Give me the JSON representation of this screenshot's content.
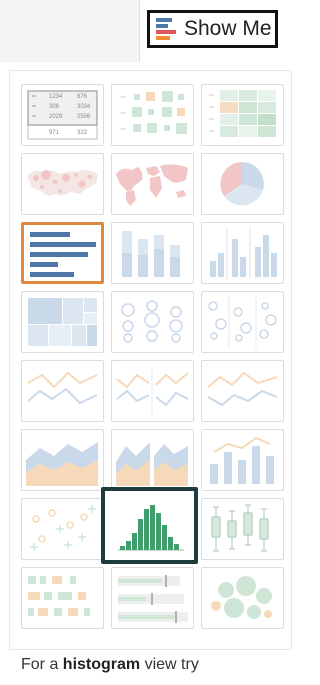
{
  "showme": {
    "label": "Show Me",
    "icon": "show-me-bars-icon",
    "icon_colors": [
      "#4e79a7",
      "#e15759",
      "#f28e2b"
    ]
  },
  "charts": [
    {
      "id": "text-table",
      "state": "muted"
    },
    {
      "id": "heat-map",
      "state": "muted"
    },
    {
      "id": "highlight-table",
      "state": "muted"
    },
    {
      "id": "symbol-map",
      "state": "muted"
    },
    {
      "id": "filled-map",
      "state": "muted"
    },
    {
      "id": "pie-chart",
      "state": "muted"
    },
    {
      "id": "horizontal-bars",
      "state": "selected"
    },
    {
      "id": "stacked-bars",
      "state": "muted"
    },
    {
      "id": "side-by-side-bars",
      "state": "muted"
    },
    {
      "id": "treemap",
      "state": "muted"
    },
    {
      "id": "circle-views",
      "state": "muted"
    },
    {
      "id": "side-by-side-circles",
      "state": "muted"
    },
    {
      "id": "lines-continuous",
      "state": "muted"
    },
    {
      "id": "lines-discrete",
      "state": "muted"
    },
    {
      "id": "dual-lines",
      "state": "muted"
    },
    {
      "id": "area-continuous",
      "state": "muted"
    },
    {
      "id": "area-discrete",
      "state": "muted"
    },
    {
      "id": "dual-combination",
      "state": "muted"
    },
    {
      "id": "scatter-plot",
      "state": "muted"
    },
    {
      "id": "histogram",
      "state": "suggested"
    },
    {
      "id": "box-and-whisker",
      "state": "muted"
    },
    {
      "id": "gantt-chart",
      "state": "muted"
    },
    {
      "id": "bullet-graph",
      "state": "muted"
    },
    {
      "id": "packed-bubbles",
      "state": "muted"
    }
  ],
  "text_table": {
    "cells": [
      "1234",
      "676",
      "306",
      "3034",
      "2029",
      "2506",
      "971",
      "322"
    ]
  },
  "hint": {
    "prefix": "For a ",
    "chart_name": "histogram",
    "suffix": " view try"
  },
  "colors": {
    "selected_border": "#e0883c",
    "suggested_border": "#1e3c3c",
    "muted_blue": "#c9d9ea",
    "muted_orange": "#f6d9b8",
    "muted_green": "#cfe6d6",
    "muted_red": "#f2c6c6",
    "active_blue": "#4e79a7",
    "active_green": "#3f9e6b"
  }
}
